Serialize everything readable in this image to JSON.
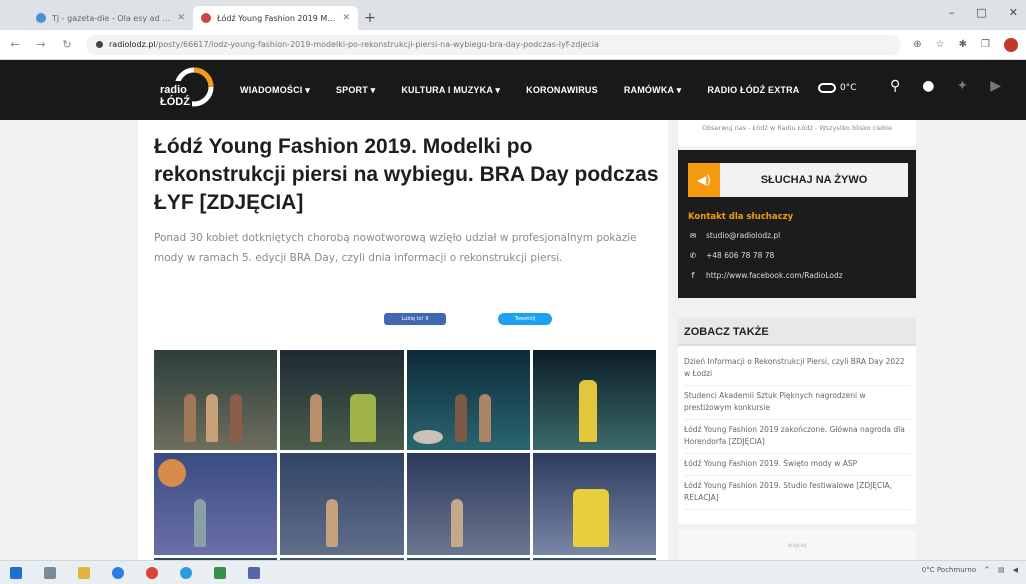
{
  "browser": {
    "tabs": [
      {
        "title": "Tj - gazeta-die - Ola esy ad kangis",
        "active": false
      },
      {
        "title": "Łódź Young Fashion 2019 Model",
        "active": true
      }
    ],
    "new_tab": "+",
    "url_host": "radiolodz.pl",
    "url_path": "/posty/66617/lodz-young-fashion-2019-modelki-po-rekonstrukcji-piersi-na-wybiegu-bra-day-podczas-lyf-zdjecia",
    "window_controls": [
      "–",
      "□",
      "✕"
    ]
  },
  "site": {
    "logo_top": "radio",
    "logo_bottom": "ŁÓDŹ",
    "nav": [
      "WIADOMOŚCI ▾",
      "SPORT ▾",
      "KULTURA I MUZYKA ▾",
      "KORONAWIRUS",
      "RAMÓWKA ▾",
      "RADIO ŁÓDŹ EXTRA"
    ],
    "weather": "0°C"
  },
  "article": {
    "title": "Łódź Young Fashion 2019. Modelki po rekonstrukcji piersi na wybiegu. BRA Day podczas ŁYF [ZDJĘCIA]",
    "lead": "Ponad 30 kobiet dotkniętych chorobą nowotworową wzięło udział w profesjonalnym pokazie mody w ramach 5. edycji BRA Day, czyli dnia informacji o rekonstrukcji piersi.",
    "share_fb": "Lubię to! 9",
    "share_tw": "Tweetnij"
  },
  "sidebar": {
    "top_note": "Obserwuj nas - Łódź w Radiu Łódź - Wszystko blisko ciebie",
    "listen_label": "SŁUCHAJ NA ŻYWO",
    "contact_heading": "Kontakt dla słuchaczy",
    "contact_email": "studio@radiolodz.pl",
    "contact_phone": "+48 606 78 78 78",
    "contact_fb": "http://www.facebook.com/RadioLodz",
    "see_also_heading": "ZOBACZ TAKŻE",
    "see_also": [
      "Dzień Informacji o Rekonstrukcji Piersi, czyli BRA Day 2022 w Łodzi",
      "Studenci Akademii Sztuk Pięknych nagrodzeni w prestiżowym konkursie",
      "Łódź Young Fashion 2019 zakończone. Główna nagroda dla Horendorfa [ZDJĘCIA]",
      "Łódź Young Fashion 2019. Święto mody w ASP",
      "Łódź Young Fashion 2019. Studio festiwalowe [ZDJĘCIA, RELACJA]"
    ],
    "bottom_note": "więcej"
  },
  "taskbar": {
    "tray_text": "0°C  Pochmurno"
  },
  "colors": {
    "accent": "#f39c12",
    "nav_bg": "#191919",
    "facebook": "#4267b2",
    "twitter": "#1da1f2"
  }
}
